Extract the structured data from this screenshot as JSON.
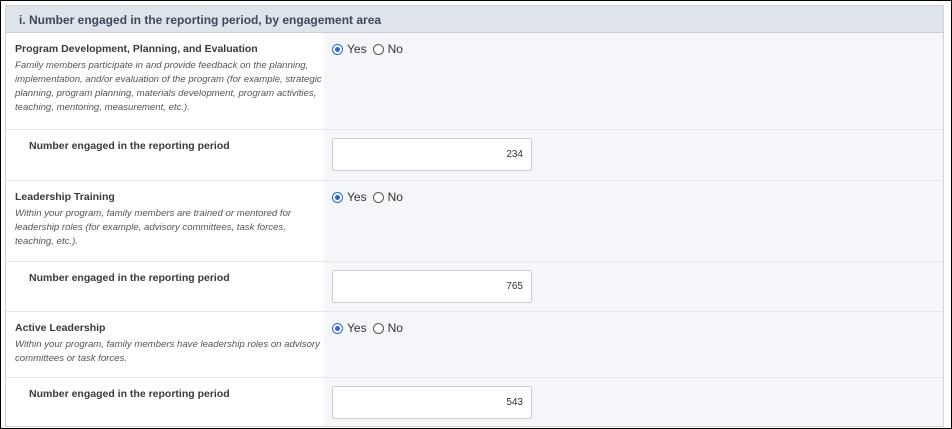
{
  "section": {
    "title": "i. Number engaged in the reporting period, by engagement area"
  },
  "areas": [
    {
      "title": "Program Development, Planning, and Evaluation",
      "description": "Family members participate in and provide feedback on the planning, implementation, and/or evaluation of the program (for example, strategic planning, program planning, materials development, program activities, teaching, mentoring, measurement, etc.).",
      "yes_label": "Yes",
      "no_label": "No",
      "selected": "Yes",
      "number_label": "Number engaged in the reporting period",
      "number_value": "234"
    },
    {
      "title": "Leadership Training",
      "description": "Within your program, family members are trained or mentored for leadership roles (for example, advisory committees, task forces, teaching, etc.).",
      "yes_label": "Yes",
      "no_label": "No",
      "selected": "Yes",
      "number_label": "Number engaged in the reporting period",
      "number_value": "765"
    },
    {
      "title": "Active Leadership",
      "description": "Within your program, family members have leadership roles on advisory committees or task forces.",
      "yes_label": "Yes",
      "no_label": "No",
      "selected": "Yes",
      "number_label": "Number engaged in the reporting period",
      "number_value": "543"
    }
  ]
}
